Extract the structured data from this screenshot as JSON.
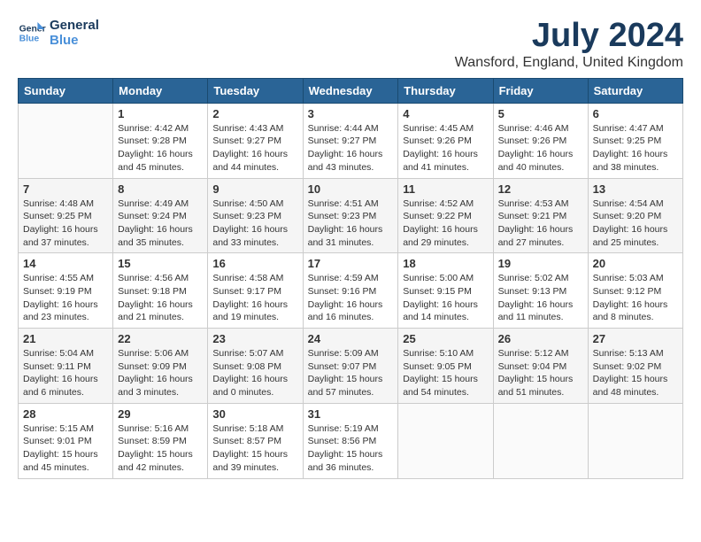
{
  "header": {
    "logo_line1": "General",
    "logo_line2": "Blue",
    "month_year": "July 2024",
    "location": "Wansford, England, United Kingdom"
  },
  "days_of_week": [
    "Sunday",
    "Monday",
    "Tuesday",
    "Wednesday",
    "Thursday",
    "Friday",
    "Saturday"
  ],
  "weeks": [
    [
      {
        "day": "",
        "empty": true
      },
      {
        "day": "1",
        "sunrise": "4:42 AM",
        "sunset": "9:28 PM",
        "daylight": "16 hours and 45 minutes."
      },
      {
        "day": "2",
        "sunrise": "4:43 AM",
        "sunset": "9:27 PM",
        "daylight": "16 hours and 44 minutes."
      },
      {
        "day": "3",
        "sunrise": "4:44 AM",
        "sunset": "9:27 PM",
        "daylight": "16 hours and 43 minutes."
      },
      {
        "day": "4",
        "sunrise": "4:45 AM",
        "sunset": "9:26 PM",
        "daylight": "16 hours and 41 minutes."
      },
      {
        "day": "5",
        "sunrise": "4:46 AM",
        "sunset": "9:26 PM",
        "daylight": "16 hours and 40 minutes."
      },
      {
        "day": "6",
        "sunrise": "4:47 AM",
        "sunset": "9:25 PM",
        "daylight": "16 hours and 38 minutes."
      }
    ],
    [
      {
        "day": "7",
        "sunrise": "4:48 AM",
        "sunset": "9:25 PM",
        "daylight": "16 hours and 37 minutes."
      },
      {
        "day": "8",
        "sunrise": "4:49 AM",
        "sunset": "9:24 PM",
        "daylight": "16 hours and 35 minutes."
      },
      {
        "day": "9",
        "sunrise": "4:50 AM",
        "sunset": "9:23 PM",
        "daylight": "16 hours and 33 minutes."
      },
      {
        "day": "10",
        "sunrise": "4:51 AM",
        "sunset": "9:23 PM",
        "daylight": "16 hours and 31 minutes."
      },
      {
        "day": "11",
        "sunrise": "4:52 AM",
        "sunset": "9:22 PM",
        "daylight": "16 hours and 29 minutes."
      },
      {
        "day": "12",
        "sunrise": "4:53 AM",
        "sunset": "9:21 PM",
        "daylight": "16 hours and 27 minutes."
      },
      {
        "day": "13",
        "sunrise": "4:54 AM",
        "sunset": "9:20 PM",
        "daylight": "16 hours and 25 minutes."
      }
    ],
    [
      {
        "day": "14",
        "sunrise": "4:55 AM",
        "sunset": "9:19 PM",
        "daylight": "16 hours and 23 minutes."
      },
      {
        "day": "15",
        "sunrise": "4:56 AM",
        "sunset": "9:18 PM",
        "daylight": "16 hours and 21 minutes."
      },
      {
        "day": "16",
        "sunrise": "4:58 AM",
        "sunset": "9:17 PM",
        "daylight": "16 hours and 19 minutes."
      },
      {
        "day": "17",
        "sunrise": "4:59 AM",
        "sunset": "9:16 PM",
        "daylight": "16 hours and 16 minutes."
      },
      {
        "day": "18",
        "sunrise": "5:00 AM",
        "sunset": "9:15 PM",
        "daylight": "16 hours and 14 minutes."
      },
      {
        "day": "19",
        "sunrise": "5:02 AM",
        "sunset": "9:13 PM",
        "daylight": "16 hours and 11 minutes."
      },
      {
        "day": "20",
        "sunrise": "5:03 AM",
        "sunset": "9:12 PM",
        "daylight": "16 hours and 8 minutes."
      }
    ],
    [
      {
        "day": "21",
        "sunrise": "5:04 AM",
        "sunset": "9:11 PM",
        "daylight": "16 hours and 6 minutes."
      },
      {
        "day": "22",
        "sunrise": "5:06 AM",
        "sunset": "9:09 PM",
        "daylight": "16 hours and 3 minutes."
      },
      {
        "day": "23",
        "sunrise": "5:07 AM",
        "sunset": "9:08 PM",
        "daylight": "16 hours and 0 minutes."
      },
      {
        "day": "24",
        "sunrise": "5:09 AM",
        "sunset": "9:07 PM",
        "daylight": "15 hours and 57 minutes."
      },
      {
        "day": "25",
        "sunrise": "5:10 AM",
        "sunset": "9:05 PM",
        "daylight": "15 hours and 54 minutes."
      },
      {
        "day": "26",
        "sunrise": "5:12 AM",
        "sunset": "9:04 PM",
        "daylight": "15 hours and 51 minutes."
      },
      {
        "day": "27",
        "sunrise": "5:13 AM",
        "sunset": "9:02 PM",
        "daylight": "15 hours and 48 minutes."
      }
    ],
    [
      {
        "day": "28",
        "sunrise": "5:15 AM",
        "sunset": "9:01 PM",
        "daylight": "15 hours and 45 minutes."
      },
      {
        "day": "29",
        "sunrise": "5:16 AM",
        "sunset": "8:59 PM",
        "daylight": "15 hours and 42 minutes."
      },
      {
        "day": "30",
        "sunrise": "5:18 AM",
        "sunset": "8:57 PM",
        "daylight": "15 hours and 39 minutes."
      },
      {
        "day": "31",
        "sunrise": "5:19 AM",
        "sunset": "8:56 PM",
        "daylight": "15 hours and 36 minutes."
      },
      {
        "day": "",
        "empty": true
      },
      {
        "day": "",
        "empty": true
      },
      {
        "day": "",
        "empty": true
      }
    ]
  ]
}
